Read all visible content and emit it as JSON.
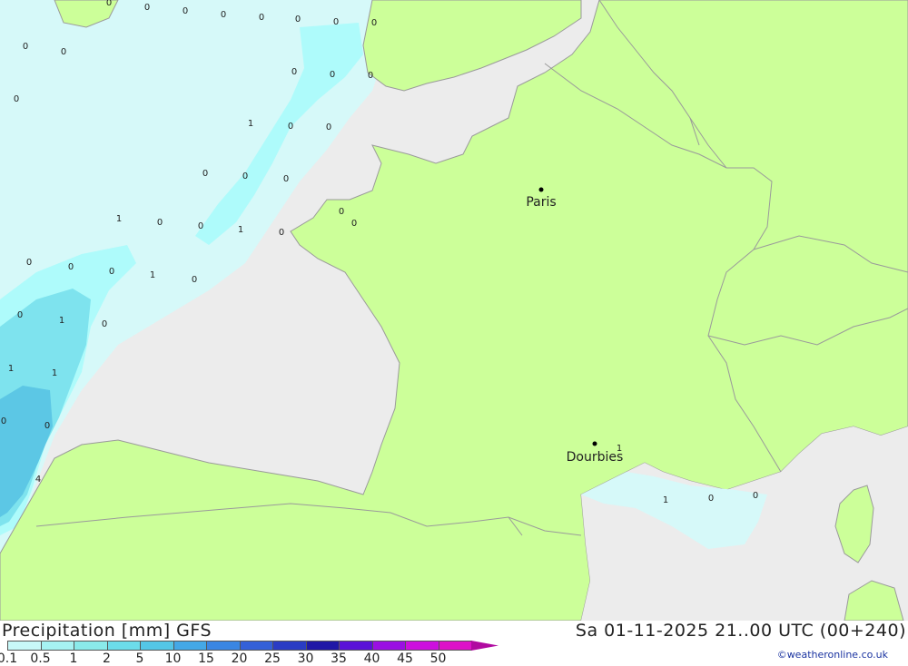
{
  "map": {
    "cities": [
      {
        "name": "Paris"
      },
      {
        "name": "Dourbies"
      }
    ],
    "value_labels": [
      "0",
      "0",
      "0",
      "0",
      "0",
      "0",
      "0",
      "0",
      "0",
      "0",
      "0",
      "0",
      "0",
      "0",
      "1",
      "0",
      "0",
      "0",
      "0",
      "0",
      "1",
      "0",
      "0",
      "1",
      "0",
      "0",
      "0",
      "0",
      "1",
      "0",
      "0",
      "1",
      "0",
      "1",
      "1",
      "0",
      "0",
      "4",
      "1",
      "1",
      "0",
      "0",
      "0",
      "0"
    ],
    "colors": {
      "land": "#ccff99",
      "sea": "#ececec",
      "border": "#9a9a9a",
      "precip_light": "#d6f9f9",
      "precip_mid": "#aefbfb",
      "precip_heavy": "#7ee3ee",
      "precip_strong": "#5cc7e5"
    }
  },
  "footer": {
    "title": "Precipitation [mm] GFS",
    "date": "Sa 01-11-2025 21..00 UTC (00+240)",
    "credit": "©weatheronline.co.uk",
    "scale_labels": [
      "0.1",
      "0.5",
      "1",
      "2",
      "5",
      "10",
      "15",
      "20",
      "25",
      "30",
      "35",
      "40",
      "45",
      "50"
    ],
    "scale_colors": [
      "#c8f8f8",
      "#a6f2f2",
      "#8aeaea",
      "#6cdcea",
      "#54c6e6",
      "#44a8e6",
      "#3a86e2",
      "#3460d8",
      "#2a3cc4",
      "#2018a6",
      "#5a12d8",
      "#9a10e2",
      "#cc10de",
      "#dd12c8",
      "#b00aa0"
    ]
  }
}
